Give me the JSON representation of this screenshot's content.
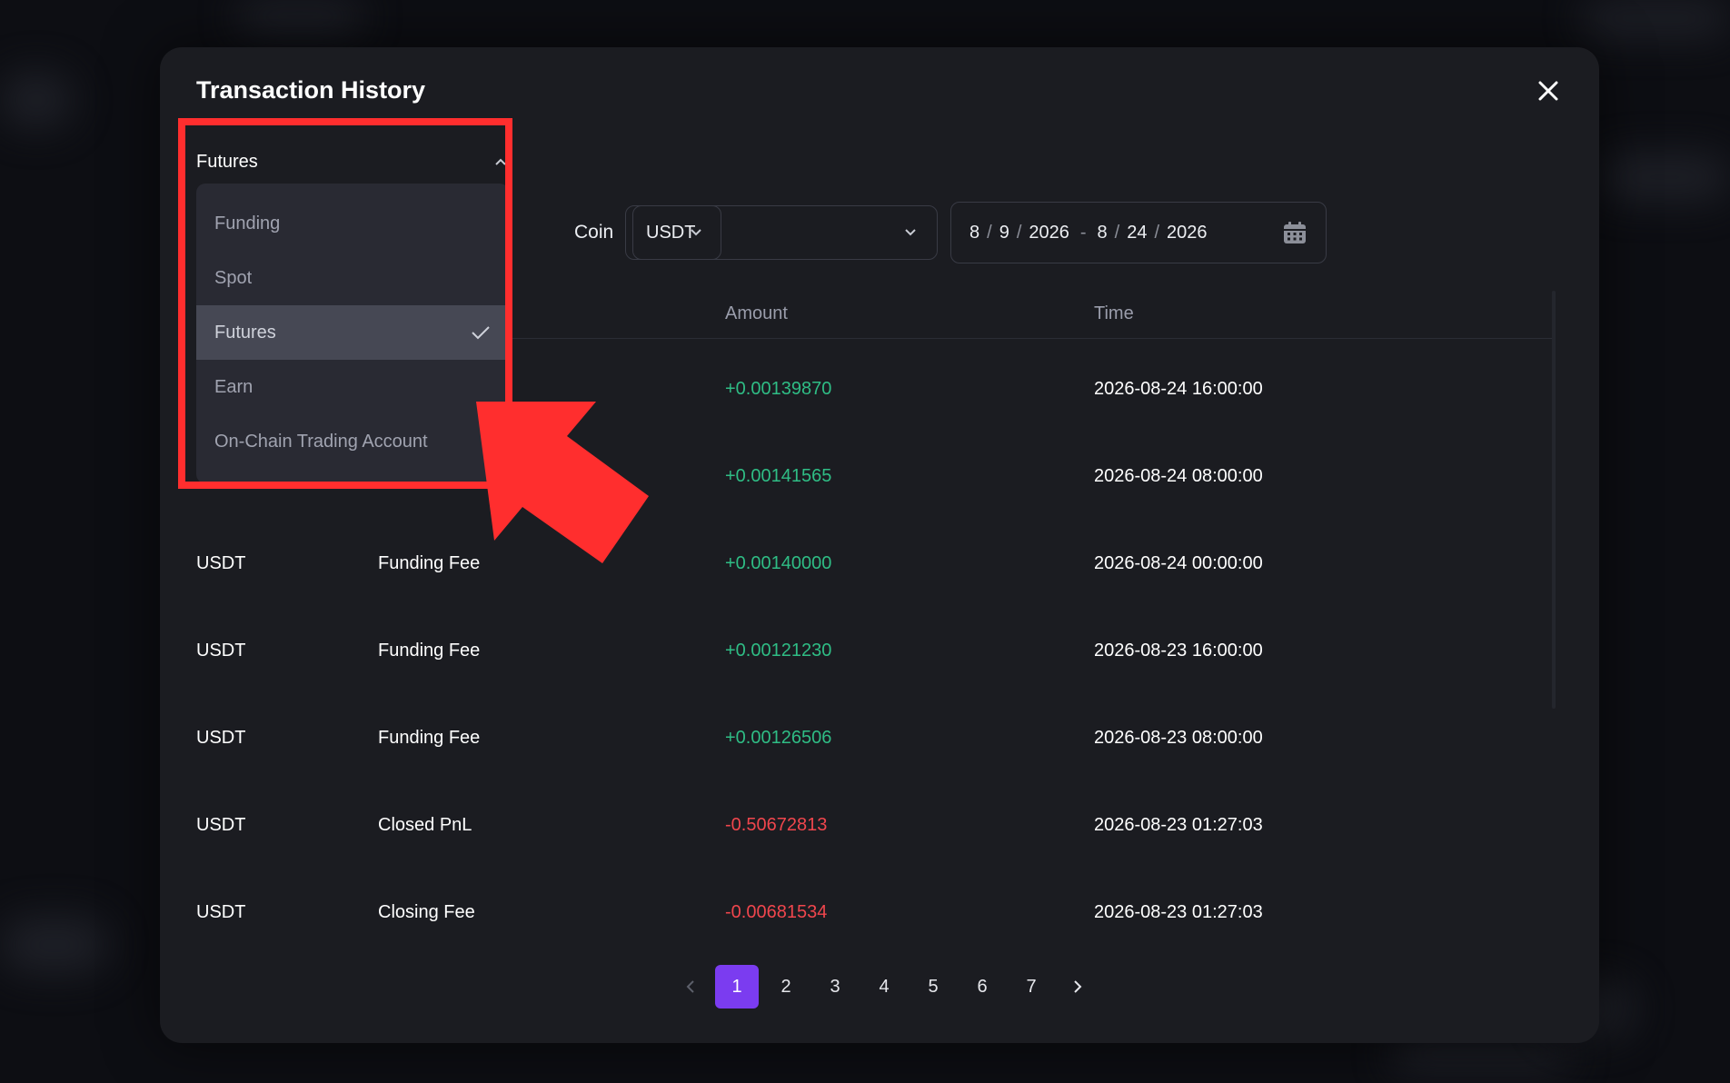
{
  "modal": {
    "title": "Transaction History"
  },
  "account_dropdown": {
    "selected": "Futures",
    "options": [
      {
        "label": "Funding",
        "selected": false
      },
      {
        "label": "Spot",
        "selected": false
      },
      {
        "label": "Futures",
        "selected": true
      },
      {
        "label": "Earn",
        "selected": false
      },
      {
        "label": "On-Chain Trading Account",
        "selected": false
      }
    ]
  },
  "filters": {
    "coin_label": "Coin",
    "coin_value": "USDT",
    "date_start": {
      "month": "8",
      "day": "9",
      "year": "2026"
    },
    "date_end": {
      "month": "8",
      "day": "24",
      "year": "2026"
    },
    "date_separator": "-",
    "part_separator": "/"
  },
  "table": {
    "columns": {
      "amount": "Amount",
      "time": "Time"
    },
    "rows": [
      {
        "coin": "",
        "type": "",
        "amount": "+0.00139870",
        "time": "2026-08-24 16:00:00",
        "sign": "pos"
      },
      {
        "coin": "",
        "type": "",
        "amount": "+0.00141565",
        "time": "2026-08-24 08:00:00",
        "sign": "pos"
      },
      {
        "coin": "USDT",
        "type": "Funding Fee",
        "amount": "+0.00140000",
        "time": "2026-08-24 00:00:00",
        "sign": "pos"
      },
      {
        "coin": "USDT",
        "type": "Funding Fee",
        "amount": "+0.00121230",
        "time": "2026-08-23 16:00:00",
        "sign": "pos"
      },
      {
        "coin": "USDT",
        "type": "Funding Fee",
        "amount": "+0.00126506",
        "time": "2026-08-23 08:00:00",
        "sign": "pos"
      },
      {
        "coin": "USDT",
        "type": "Closed PnL",
        "amount": "-0.50672813",
        "time": "2026-08-23 01:27:03",
        "sign": "neg"
      },
      {
        "coin": "USDT",
        "type": "Closing Fee",
        "amount": "-0.00681534",
        "time": "2026-08-23 01:27:03",
        "sign": "neg"
      }
    ]
  },
  "pagination": {
    "pages": [
      "1",
      "2",
      "3",
      "4",
      "5",
      "6",
      "7"
    ],
    "current": "1"
  },
  "colors": {
    "positive": "#2fbd85",
    "negative": "#f0464d",
    "accent": "#7b3cf0",
    "highlight": "#ff2e2e"
  }
}
